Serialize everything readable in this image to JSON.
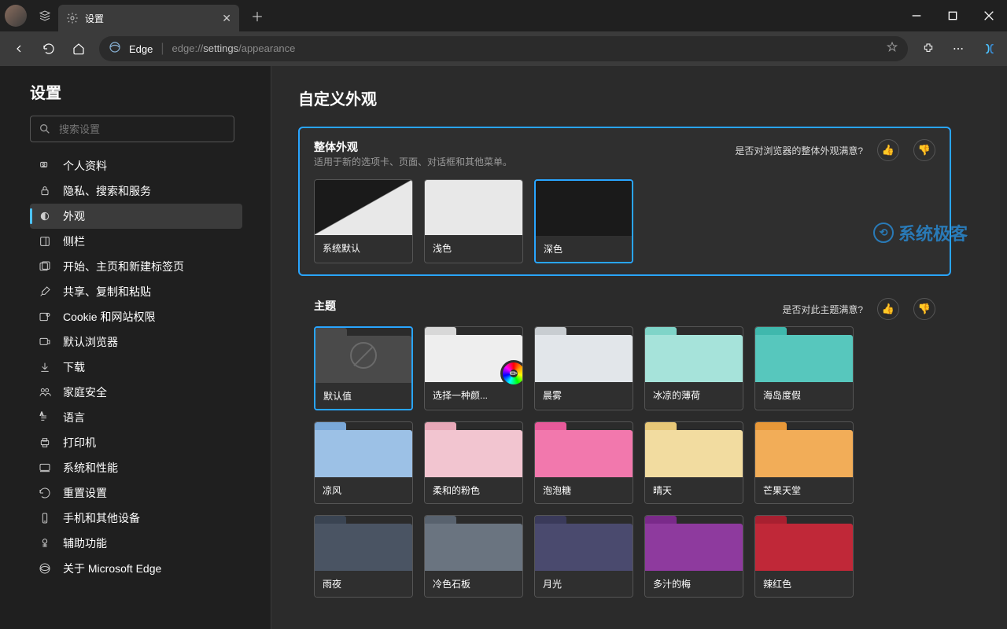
{
  "tab": {
    "title": "设置"
  },
  "url": {
    "site": "Edge",
    "proto": "edge://",
    "path1": "settings",
    "path2": "/appearance"
  },
  "sidebar": {
    "title": "设置",
    "search_placeholder": "搜索设置",
    "items": [
      {
        "label": "个人资料"
      },
      {
        "label": "隐私、搜索和服务"
      },
      {
        "label": "外观"
      },
      {
        "label": "侧栏"
      },
      {
        "label": "开始、主页和新建标签页"
      },
      {
        "label": "共享、复制和粘贴"
      },
      {
        "label": "Cookie 和网站权限"
      },
      {
        "label": "默认浏览器"
      },
      {
        "label": "下载"
      },
      {
        "label": "家庭安全"
      },
      {
        "label": "语言"
      },
      {
        "label": "打印机"
      },
      {
        "label": "系统和性能"
      },
      {
        "label": "重置设置"
      },
      {
        "label": "手机和其他设备"
      },
      {
        "label": "辅助功能"
      },
      {
        "label": "关于 Microsoft Edge"
      }
    ]
  },
  "page": {
    "title": "自定义外观"
  },
  "overall": {
    "title": "整体外观",
    "desc": "适用于新的选项卡、页面、对话框和其他菜单。",
    "feedback": "是否对浏览器的整体外观满意?",
    "options": [
      {
        "label": "系统默认"
      },
      {
        "label": "浅色"
      },
      {
        "label": "深色"
      }
    ]
  },
  "themes": {
    "title": "主题",
    "feedback": "是否对此主题满意?",
    "items": [
      {
        "label": "默认值",
        "tab": "#4a4a4a",
        "body": "#4a4a4a"
      },
      {
        "label": "选择一种颜...",
        "tab": "#d8d8d8",
        "body": "#eeeeee"
      },
      {
        "label": "晨雾",
        "tab": "#c8cdd1",
        "body": "#e2e6ea"
      },
      {
        "label": "冰凉的薄荷",
        "tab": "#7fd4c8",
        "body": "#a6e3da"
      },
      {
        "label": "海岛度假",
        "tab": "#3fb8ad",
        "body": "#57c7bd"
      },
      {
        "label": "凉风",
        "tab": "#7aa8d8",
        "body": "#9cc1e6"
      },
      {
        "label": "柔和的粉色",
        "tab": "#e8a8b8",
        "body": "#f2c5d0"
      },
      {
        "label": "泡泡糖",
        "tab": "#e85a9a",
        "body": "#f278ad"
      },
      {
        "label": "晴天",
        "tab": "#e8c878",
        "body": "#f2dca0"
      },
      {
        "label": "芒果天堂",
        "tab": "#e89838",
        "body": "#f2ad58"
      },
      {
        "label": "雨夜",
        "tab": "#3a4452",
        "body": "#4a5463"
      },
      {
        "label": "冷色石板",
        "tab": "#58626e",
        "body": "#6a7480"
      },
      {
        "label": "月光",
        "tab": "#3a3a5a",
        "body": "#4a4a6e"
      },
      {
        "label": "多汁的梅",
        "tab": "#7a2a8a",
        "body": "#8e3a9e"
      },
      {
        "label": "辣红色",
        "tab": "#a82030",
        "body": "#c02838"
      }
    ]
  },
  "watermark": "系统极客"
}
